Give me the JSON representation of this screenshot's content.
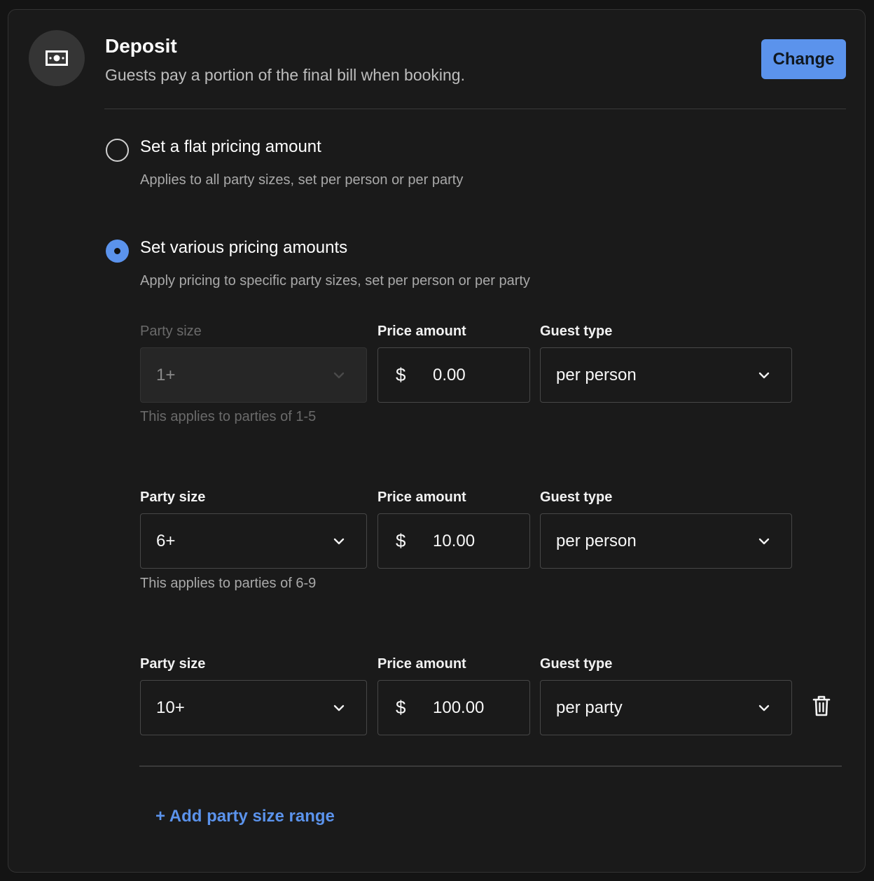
{
  "header": {
    "title": "Deposit",
    "subtitle": "Guests pay a portion of the final bill when booking.",
    "change_label": "Change",
    "icon": "cash-icon"
  },
  "options": [
    {
      "label": "Set a flat pricing amount",
      "description": "Applies to all party sizes, set per person or per party",
      "selected": false
    },
    {
      "label": "Set various pricing amounts",
      "description": "Apply pricing to specific party sizes, set per person or per party",
      "selected": true
    }
  ],
  "labels": {
    "party_size": "Party size",
    "price_amount": "Price amount",
    "guest_type": "Guest type",
    "currency": "$"
  },
  "ranges": [
    {
      "party_size": "1+",
      "price": "0.00",
      "guest_type": "per person",
      "helper": "This applies to parties of 1-5",
      "disabled": true
    },
    {
      "party_size": "6+",
      "price": "10.00",
      "guest_type": "per person",
      "helper": "This applies to parties of 6-9",
      "disabled": false
    },
    {
      "party_size": "10+",
      "price": "100.00",
      "guest_type": "per party",
      "helper": "",
      "disabled": false
    }
  ],
  "add_range_label": "+ Add party size range",
  "colors": {
    "accent": "#5b93ec",
    "background": "#1a1a1a"
  }
}
